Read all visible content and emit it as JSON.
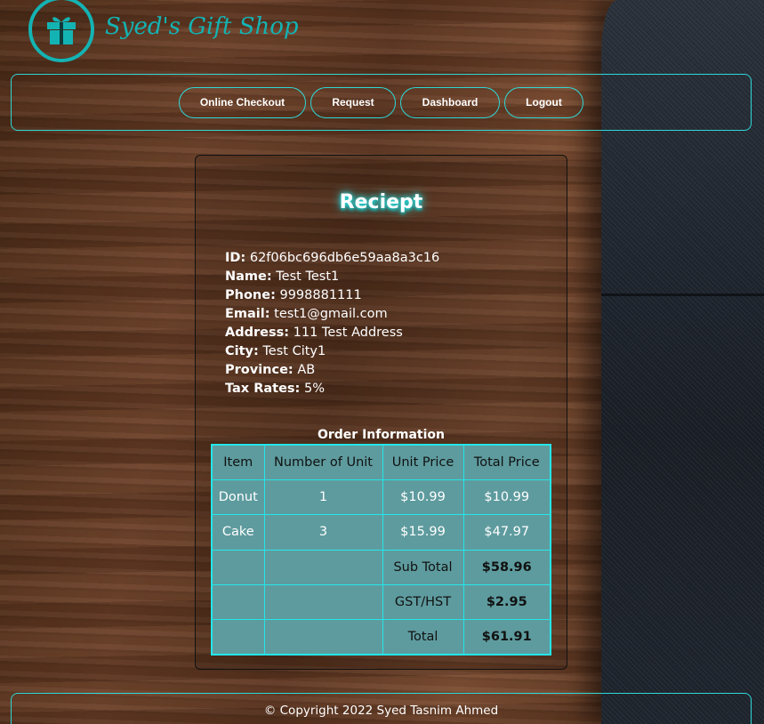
{
  "brand": {
    "name": "Syed's Gift Shop",
    "accent": "#14b3b3",
    "icon": "gift-icon"
  },
  "nav": {
    "items": [
      "Online Checkout",
      "Request",
      "Dashboard",
      "Logout"
    ]
  },
  "receipt": {
    "title": "Reciept",
    "fields": [
      {
        "label": "ID:",
        "value": " 62f06bc696db6e59aa8a3c16"
      },
      {
        "label": "Name:",
        "value": " Test Test1"
      },
      {
        "label": "Phone:",
        "value": " 9998881111"
      },
      {
        "label": "Email:",
        "value": " test1@gmail.com"
      },
      {
        "label": "Address:",
        "value": " 111 Test Address"
      },
      {
        "label": "City:",
        "value": " Test City1"
      },
      {
        "label": "Province:",
        "value": " AB"
      },
      {
        "label": "Tax Rates:",
        "value": " 5%"
      }
    ]
  },
  "order": {
    "title": "Order Information",
    "headers": [
      "Item",
      "Number of Unit",
      "Unit Price",
      "Total Price"
    ],
    "rows": [
      [
        "Donut",
        "1",
        "$10.99",
        "$10.99"
      ],
      [
        "Cake",
        "3",
        "$15.99",
        "$47.97"
      ]
    ],
    "totals": [
      {
        "label": "Sub Total",
        "value": "$58.96"
      },
      {
        "label": "GST/HST",
        "value": "$2.95"
      },
      {
        "label": "Total",
        "value": "$61.91"
      }
    ]
  },
  "footer": {
    "copyright": "© Copyright 2022 Syed Tasnim Ahmed"
  }
}
